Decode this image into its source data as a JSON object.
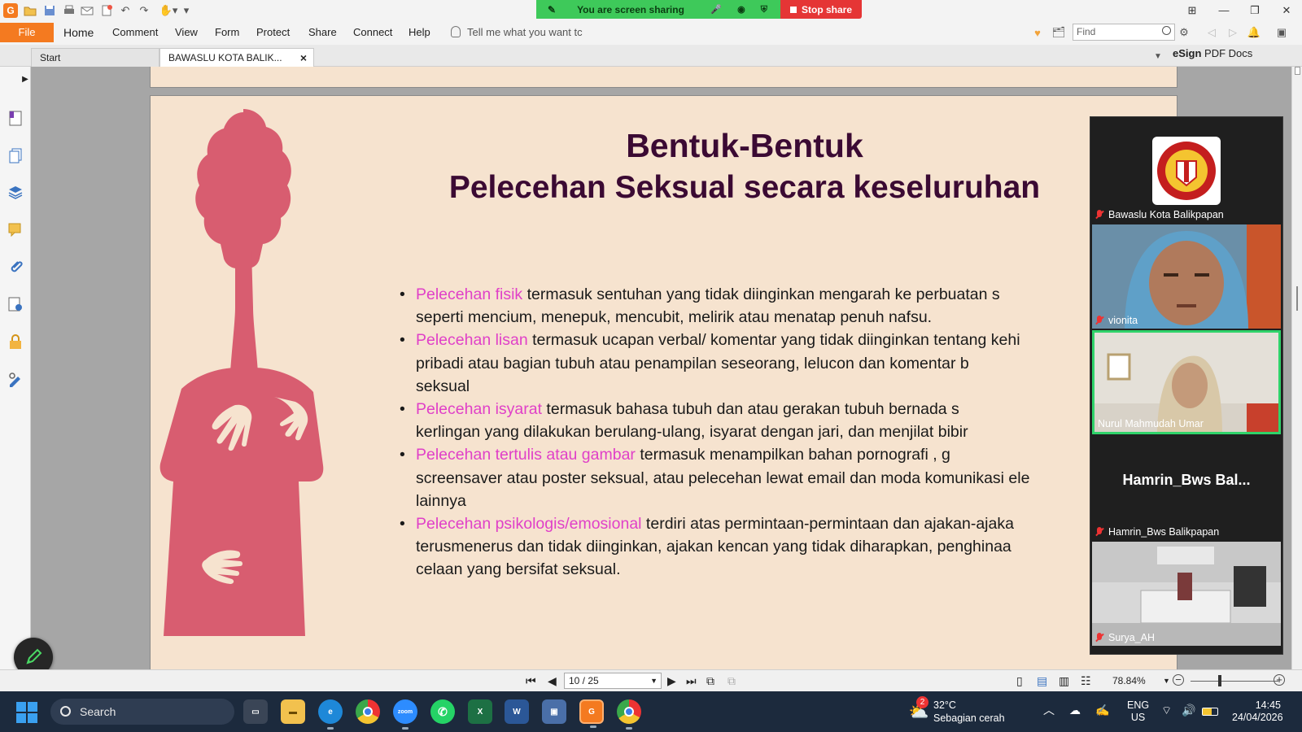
{
  "share": {
    "banner_text": "You are screen sharing",
    "stop_label": "Stop share"
  },
  "menu": {
    "file": "File",
    "items": [
      "Home",
      "Comment",
      "View",
      "Form",
      "Protect",
      "Share",
      "Connect",
      "Help"
    ],
    "tellme": "Tell me what you want tc",
    "find_placeholder": "Find"
  },
  "tabs": {
    "start": "Start",
    "doc": "BAWASLU KOTA BALIK..."
  },
  "esign": {
    "brand": "eSign",
    "suffix": "PDF Docs"
  },
  "slide": {
    "title_line1": "Bentuk-Bentuk",
    "title_line2": "Pelecehan Seksual secara keseluruhan",
    "bullets": [
      {
        "keyword": "Pelecehan fisik",
        "line1": " termasuk sentuhan yang tidak diinginkan mengarah ke perbuatan s",
        "line2": "seperti mencium, menepuk, mencubit, melirik atau menatap penuh nafsu."
      },
      {
        "keyword": "Pelecehan lisan",
        "line1": " termasuk ucapan verbal/ komentar yang tidak diinginkan tentang kehi",
        "line2": "pribadi atau bagian tubuh atau penampilan seseorang, lelucon dan komentar b",
        "line3": "seksual"
      },
      {
        "keyword": "Pelecehan isyarat",
        "line1": " termasuk bahasa tubuh dan atau gerakan tubuh bernada s",
        "line2": "kerlingan  yang dilakukan berulang-ulang, isyarat dengan jari, dan menjilat bibir"
      },
      {
        "keyword": "Pelecehan tertulis atau gambar",
        "line1": " termasuk menampilkan bahan pornografi , g",
        "line2": "screensaver atau poster seksual, atau pelecehan lewat email dan moda komunikasi ele",
        "line3": "lainnya"
      },
      {
        "keyword": "Pelecehan psikologis/emosional",
        "line1": " terdiri atas permintaan-permintaan dan ajakan-ajaka",
        "line2": "terusmenerus dan tidak diinginkan, ajakan kencan yang tidak diharapkan, penghinaa",
        "line3": "celaan yang bersifat seksual."
      }
    ]
  },
  "participants": [
    {
      "name": "Bawaslu Kota Balikpapan",
      "type": "logo"
    },
    {
      "name": "vionita",
      "type": "video"
    },
    {
      "name": "Nurul Mahmudah Umar",
      "type": "video",
      "speaking": true
    },
    {
      "name": "Hamrin_Bws Balikpapan",
      "display": "Hamrin_Bws  Bal...",
      "type": "name"
    },
    {
      "name": "Surya_AH",
      "type": "video"
    }
  ],
  "statusbar": {
    "page": "10 / 25",
    "zoom": "78.84%"
  },
  "taskbar": {
    "search": "Search",
    "weather_temp": "32°C",
    "weather_desc": "Sebagian cerah",
    "weather_badge": "2",
    "lang1": "ENG",
    "lang2": "US",
    "time": "14:45",
    "date": "24/04/2026"
  },
  "colors": {
    "accent_orange": "#f47a20",
    "share_green": "#3ec95a",
    "stop_red": "#e53535",
    "slide_bg": "#f6e3cf",
    "title_color": "#3b0a33",
    "keyword_pink": "#e040c8",
    "figure_pink": "#d85d70"
  }
}
